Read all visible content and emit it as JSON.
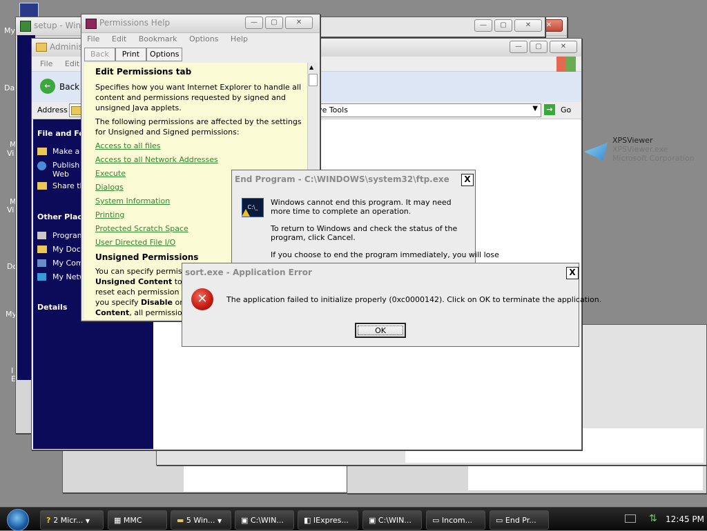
{
  "desktop": {
    "icon_labels": [
      "My",
      "Da",
      "M",
      "Vi",
      "M",
      "Vi",
      "Do",
      "My",
      "I",
      "E"
    ]
  },
  "setup_window": {
    "title": "setup - Wind"
  },
  "admin_window": {
    "title": "Administ",
    "menu": [
      "File",
      "Edit"
    ],
    "back_label": "Back",
    "address_label": "Address",
    "address_value": "ive Tools",
    "go_label": "Go",
    "sidebar": {
      "section1_title": "File and Fold",
      "items1": [
        "Make a",
        "Publish Web",
        "Share th"
      ],
      "section2_title": "Other Places",
      "items2": [
        "Program",
        "My Docu",
        "My Com",
        "My Netw"
      ],
      "details_title": "Details"
    },
    "file_item": {
      "name": "XPSViewer",
      "filename": "XPSViewer.exe",
      "company": "Microsoft Corporation"
    }
  },
  "help_window": {
    "title": "Permissions Help",
    "menu": [
      "File",
      "Edit",
      "Bookmark",
      "Options",
      "Help"
    ],
    "toolbar": [
      "Back",
      "Print",
      "Options"
    ],
    "heading": "Edit Permissions tab",
    "para1": "Specifies how you want Internet Explorer to handle all content and permissions requested by signed and unsigned Java applets.",
    "para2": "The following permissions are affected by the settings for Unsigned and Signed permissions:",
    "links": [
      "Access to all files",
      "Access to all Network Addresses",
      "Execute",
      "Dialogs",
      "System Information",
      "Printing",
      "Protected Scratch Space",
      "User Directed File I/O"
    ],
    "heading2": "Unsigned Permissions",
    "para3_a": "You can specify permission",
    "para3_b": "Unsigned Content",
    "para3_c": "to R",
    "para3_d": "reset each permission indiv",
    "para3_e": "you specify",
    "para3_f": "Disable",
    "para3_g": "or En",
    "para3_h": "Content",
    "para3_i": ", all permissions u"
  },
  "end_program_dialog": {
    "title": "End Program - C:\\WINDOWS\\system32\\ftp.exe",
    "close_label": "X",
    "p1": "Windows cannot end this program. It may need more time to complete an operation.",
    "p2": "To return to Windows and check the status of the program, click Cancel.",
    "p3": "If you choose to end the program immediately, you will lose"
  },
  "app_error_dialog": {
    "title": "sort.exe - Application Error",
    "close_label": "X",
    "message": "The application failed to initialize properly (0xc0000142). Click on OK to terminate the application.",
    "ok_label": "OK"
  },
  "taskbar": {
    "buttons": [
      "2 Micr...",
      "MMC",
      "5 Win...",
      "C:\\WIN...",
      "IExpres...",
      "C:\\WIN...",
      "Incom...",
      "End Pr..."
    ],
    "clock": "12:45 PM"
  },
  "colors": {
    "error_red": "#cc2222",
    "help_bg": "#fbfbd6",
    "sidebar_navy": "#0b0b5a",
    "link_green": "#2a8a2a"
  }
}
